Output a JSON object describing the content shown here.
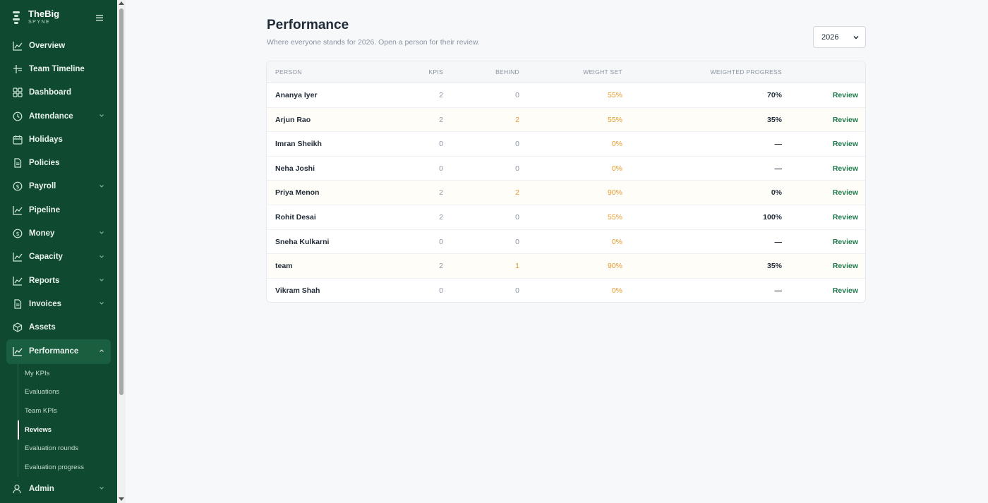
{
  "brand": {
    "name": "TheBig",
    "sub": "SPYNE"
  },
  "nav": [
    {
      "label": "Overview",
      "icon": "chart-line-icon"
    },
    {
      "label": "Team Timeline",
      "icon": "timeline-icon"
    },
    {
      "label": "Dashboard",
      "icon": "grid-icon"
    },
    {
      "label": "Attendance",
      "icon": "clock-icon",
      "expandable": true
    },
    {
      "label": "Holidays",
      "icon": "calendar-icon"
    },
    {
      "label": "Policies",
      "icon": "document-icon"
    },
    {
      "label": "Payroll",
      "icon": "dollar-icon",
      "expandable": true
    },
    {
      "label": "Pipeline",
      "icon": "chart-line-icon"
    },
    {
      "label": "Money",
      "icon": "dollar-icon",
      "expandable": true
    },
    {
      "label": "Capacity",
      "icon": "chart-line-icon",
      "expandable": true
    },
    {
      "label": "Reports",
      "icon": "chart-line-icon",
      "expandable": true
    },
    {
      "label": "Invoices",
      "icon": "document-icon",
      "expandable": true
    },
    {
      "label": "Assets",
      "icon": "box-icon"
    },
    {
      "label": "Performance",
      "icon": "chart-line-icon",
      "expandable": true,
      "expanded": true
    }
  ],
  "performance_sub": [
    {
      "label": "My KPIs"
    },
    {
      "label": "Evaluations"
    },
    {
      "label": "Team KPIs"
    },
    {
      "label": "Reviews",
      "current": true
    },
    {
      "label": "Evaluation rounds"
    },
    {
      "label": "Evaluation progress"
    }
  ],
  "nav_bottom": {
    "label": "Admin",
    "icon": "user-icon"
  },
  "page": {
    "title": "Performance",
    "subtitle": "Where everyone stands for 2026. Open a person for their review.",
    "year": "2026"
  },
  "table": {
    "headers": [
      "PERSON",
      "KPIS",
      "BEHIND",
      "WEIGHT SET",
      "WEIGHTED PROGRESS"
    ],
    "rows": [
      {
        "person": "Ananya Iyer",
        "kpis": "2",
        "behind": "0",
        "weight": "55%",
        "progress": "70%",
        "action": "Review"
      },
      {
        "person": "Arjun Rao",
        "kpis": "2",
        "behind": "2",
        "weight": "55%",
        "progress": "35%",
        "action": "Review"
      },
      {
        "person": "Imran Sheikh",
        "kpis": "0",
        "behind": "0",
        "weight": "0%",
        "progress": "—",
        "action": "Review"
      },
      {
        "person": "Neha Joshi",
        "kpis": "0",
        "behind": "0",
        "weight": "0%",
        "progress": "—",
        "action": "Review"
      },
      {
        "person": "Priya Menon",
        "kpis": "2",
        "behind": "2",
        "weight": "90%",
        "progress": "0%",
        "action": "Review"
      },
      {
        "person": "Rohit Desai",
        "kpis": "2",
        "behind": "0",
        "weight": "55%",
        "progress": "100%",
        "action": "Review"
      },
      {
        "person": "Sneha Kulkarni",
        "kpis": "0",
        "behind": "0",
        "weight": "0%",
        "progress": "—",
        "action": "Review"
      },
      {
        "person": "team",
        "kpis": "2",
        "behind": "1",
        "weight": "90%",
        "progress": "35%",
        "action": "Review"
      },
      {
        "person": "Vikram Shah",
        "kpis": "0",
        "behind": "0",
        "weight": "0%",
        "progress": "—",
        "action": "Review"
      }
    ]
  },
  "colors": {
    "sidebar": "#0f4a30",
    "accent": "#1f7a4d",
    "warning": "#e59a2e"
  }
}
